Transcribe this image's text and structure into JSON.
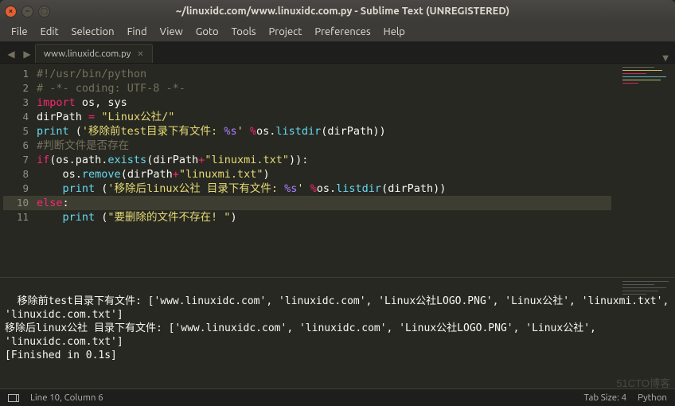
{
  "window": {
    "title": "~/linuxidc.com/www.linuxidc.com.py - Sublime Text (UNREGISTERED)"
  },
  "menu": {
    "items": [
      "File",
      "Edit",
      "Selection",
      "Find",
      "View",
      "Goto",
      "Tools",
      "Project",
      "Preferences",
      "Help"
    ]
  },
  "tabs": {
    "active": {
      "label": "www.linuxidc.com.py"
    }
  },
  "code": {
    "lines": [
      {
        "n": 1,
        "seg": [
          {
            "c": "c-comment",
            "t": "#!/usr/bin/python"
          }
        ]
      },
      {
        "n": 2,
        "seg": [
          {
            "c": "c-comment",
            "t": "# -*- coding: UTF-8 -*-"
          }
        ]
      },
      {
        "n": 3,
        "seg": [
          {
            "c": "c-kw",
            "t": "import"
          },
          {
            "c": "c-id",
            "t": " os, sys"
          }
        ]
      },
      {
        "n": 4,
        "seg": [
          {
            "c": "c-id",
            "t": "dirPath "
          },
          {
            "c": "c-op",
            "t": "="
          },
          {
            "c": "c-id",
            "t": " "
          },
          {
            "c": "c-str",
            "t": "\"Linux公社/\""
          }
        ]
      },
      {
        "n": 5,
        "seg": [
          {
            "c": "c-func",
            "t": "print"
          },
          {
            "c": "c-id",
            "t": " ("
          },
          {
            "c": "c-str",
            "t": "'移除前test目录下有文件: "
          },
          {
            "c": "c-fmt",
            "t": "%s"
          },
          {
            "c": "c-str",
            "t": "'"
          },
          {
            "c": "c-id",
            "t": " "
          },
          {
            "c": "c-op",
            "t": "%"
          },
          {
            "c": "c-id",
            "t": "os."
          },
          {
            "c": "c-func",
            "t": "listdir"
          },
          {
            "c": "c-id",
            "t": "(dirPath))"
          }
        ]
      },
      {
        "n": 6,
        "seg": [
          {
            "c": "c-comment",
            "t": "#判断文件是否存在"
          }
        ]
      },
      {
        "n": 7,
        "seg": [
          {
            "c": "c-kw",
            "t": "if"
          },
          {
            "c": "c-id",
            "t": "(os.path."
          },
          {
            "c": "c-func",
            "t": "exists"
          },
          {
            "c": "c-id",
            "t": "(dirPath"
          },
          {
            "c": "c-op",
            "t": "+"
          },
          {
            "c": "c-str",
            "t": "\"linuxmi.txt\""
          },
          {
            "c": "c-id",
            "t": ")):"
          }
        ]
      },
      {
        "n": 8,
        "seg": [
          {
            "c": "c-id",
            "t": "    os."
          },
          {
            "c": "c-func",
            "t": "remove"
          },
          {
            "c": "c-id",
            "t": "(dirPath"
          },
          {
            "c": "c-op",
            "t": "+"
          },
          {
            "c": "c-str",
            "t": "\"linuxmi.txt\""
          },
          {
            "c": "c-id",
            "t": ")"
          }
        ]
      },
      {
        "n": 9,
        "seg": [
          {
            "c": "c-id",
            "t": "    "
          },
          {
            "c": "c-func",
            "t": "print"
          },
          {
            "c": "c-id",
            "t": " ("
          },
          {
            "c": "c-str",
            "t": "'移除后linux公社 目录下有文件: "
          },
          {
            "c": "c-fmt",
            "t": "%s"
          },
          {
            "c": "c-str",
            "t": "'"
          },
          {
            "c": "c-id",
            "t": " "
          },
          {
            "c": "c-op",
            "t": "%"
          },
          {
            "c": "c-id",
            "t": "os."
          },
          {
            "c": "c-func",
            "t": "listdir"
          },
          {
            "c": "c-id",
            "t": "(dirPath))"
          }
        ]
      },
      {
        "n": 10,
        "current": true,
        "seg": [
          {
            "c": "c-kw",
            "t": "else"
          },
          {
            "c": "c-id",
            "t": ":"
          }
        ]
      },
      {
        "n": 11,
        "seg": [
          {
            "c": "c-id",
            "t": "    "
          },
          {
            "c": "c-func",
            "t": "print"
          },
          {
            "c": "c-id",
            "t": " ("
          },
          {
            "c": "c-str",
            "t": "\"要删除的文件不存在! \""
          },
          {
            "c": "c-id",
            "t": ")"
          }
        ]
      }
    ]
  },
  "output": {
    "text": "移除前test目录下有文件: ['www.linuxidc.com', 'linuxidc.com', 'Linux公社LOGO.PNG', 'Linux公社', 'linuxmi.txt', 'linuxidc.com.txt']\n移除后linux公社 目录下有文件: ['www.linuxidc.com', 'linuxidc.com', 'Linux公社LOGO.PNG', 'Linux公社', 'linuxidc.com.txt']\n[Finished in 0.1s]"
  },
  "status": {
    "position": "Line 10, Column 6",
    "tabsize": "Tab Size: 4",
    "syntax": "Python"
  },
  "watermark": "51CTO博客"
}
